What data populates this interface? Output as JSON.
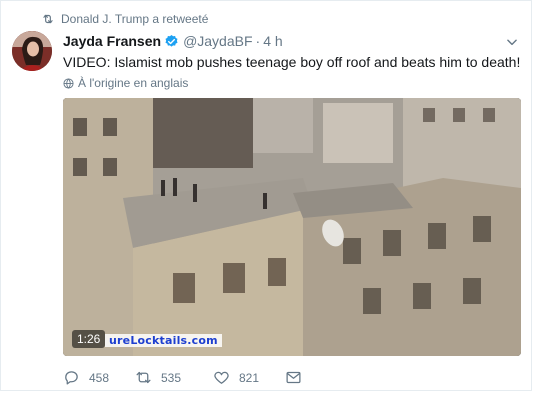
{
  "retweet_context": {
    "text": "Donald J. Trump a retweeté",
    "icon": "retweet-icon"
  },
  "tweet": {
    "author_name": "Jayda Fransen",
    "handle": "@JaydaBF",
    "separator": "·",
    "time": "4 h",
    "verified": true,
    "text": "VIDEO: Islamist mob pushes teenage boy off roof and beats him to death!",
    "translate_label": "À l'origine en anglais"
  },
  "media": {
    "duration": "1:26",
    "watermark": "ureLocktails.com"
  },
  "actions": {
    "replies": "458",
    "retweets": "535",
    "likes": "821"
  },
  "colors": {
    "text": "#14171a",
    "secondary": "#657786",
    "verified": "#1da1f2",
    "border": "#e6ecf0"
  }
}
